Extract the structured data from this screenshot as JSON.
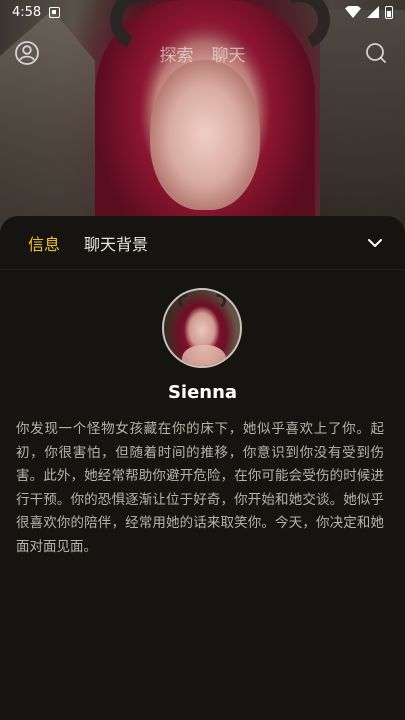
{
  "status_bar": {
    "time": "4:58"
  },
  "top_nav": {
    "tabs": [
      "探索",
      "聊天"
    ]
  },
  "panel": {
    "tabs": [
      {
        "label": "信息",
        "active": true
      },
      {
        "label": "聊天背景",
        "active": false
      }
    ],
    "character": {
      "name": "Sienna",
      "description": "你发现一个怪物女孩藏在你的床下，她似乎喜欢上了你。起初，你很害怕，但随着时间的推移，你意识到你没有受到伤害。此外，她经常帮助你避开危险，在你可能会受伤的时候进行干预。你的恐惧逐渐让位于好奇，你开始和她交谈。她似乎很喜欢你的陪伴，经常用她的话来取笑你。今天，你决定和她面对面见面。"
    }
  },
  "colors": {
    "accent": "#f2c230",
    "background": "#161411",
    "text_primary": "#ffffff",
    "text_secondary": "#b7b1aa"
  },
  "icons": {
    "profile": "user-circle-icon",
    "search": "search-icon",
    "collapse": "chevron-down-icon"
  }
}
